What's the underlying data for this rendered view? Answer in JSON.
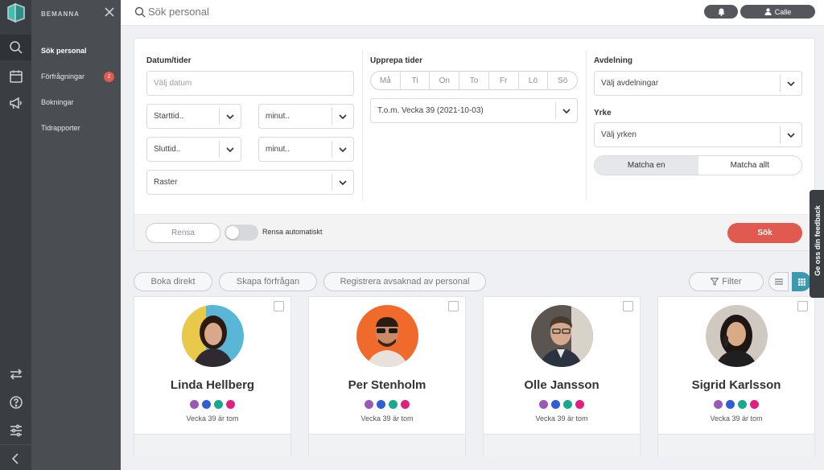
{
  "brand": "BEMANNA",
  "nav": {
    "items": [
      {
        "label": "Sök personal"
      },
      {
        "label": "Förfrågningar",
        "badge": "2"
      },
      {
        "label": "Bokningar"
      },
      {
        "label": "Tidrapporter"
      }
    ]
  },
  "topbar": {
    "search_placeholder": "Sök personal",
    "user_label": "Calle"
  },
  "filters": {
    "date_label": "Datum/tider",
    "date_placeholder": "Välj datum",
    "start_time": "Starttid..",
    "start_minute": "minut..",
    "end_time": "Sluttid..",
    "end_minute": "minut..",
    "raster": "Raster",
    "repeat_label": "Upprepa tider",
    "days": [
      "Må",
      "Ti",
      "On",
      "To",
      "Fr",
      "Lö",
      "Sö"
    ],
    "repeat_until": "T.o.m. Vecka 39 (2021-10-03)",
    "department_label": "Avdelning",
    "department_placeholder": "Välj avdelningar",
    "profession_label": "Yrke",
    "profession_placeholder": "Välj yrken",
    "match_one": "Matcha en",
    "match_all": "Matcha allt",
    "clear": "Rensa",
    "clear_auto": "Rensa automatiskt",
    "search": "Sök"
  },
  "actions": {
    "book_direct": "Boka direkt",
    "create_request": "Skapa förfrågan",
    "register_absence": "Registrera avsaknad av personal",
    "filter": "Filter"
  },
  "cards": [
    {
      "name": "Linda Hellberg",
      "sub": "Vecka 39 är tom"
    },
    {
      "name": "Per Stenholm",
      "sub": "Vecka 39 är tom"
    },
    {
      "name": "Olle Jansson",
      "sub": "Vecka 39 är tom"
    },
    {
      "name": "Sigrid Karlsson",
      "sub": "Vecka 39 är tom"
    }
  ],
  "dot_colors": [
    "#9b59b6",
    "#2e5fd6",
    "#18a88f",
    "#e0207e"
  ],
  "accent": "#e05a4f",
  "feedback": "Ge oss din feedback"
}
